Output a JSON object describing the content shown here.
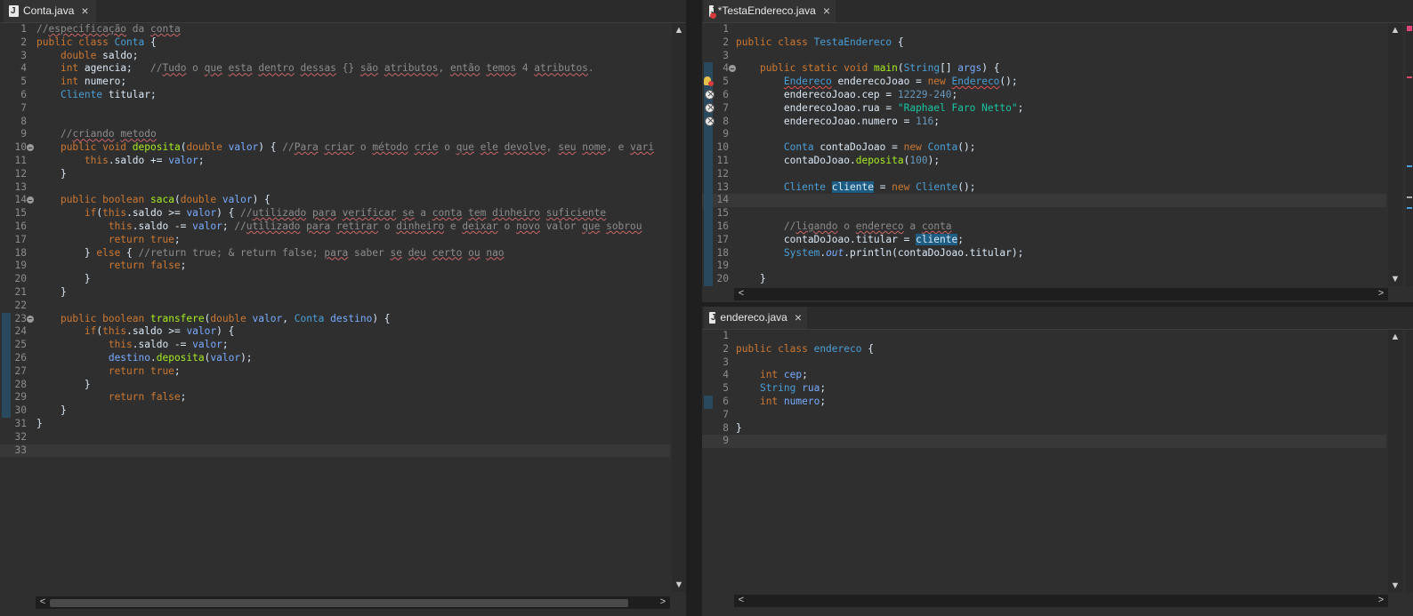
{
  "left": {
    "tab": "Conta.java",
    "lines": [
      {
        "n": 1,
        "html": "<span class=\"c\">//<span class=\"cu\">especificação</span> da <span class=\"cu\">conta</span></span>"
      },
      {
        "n": 2,
        "html": "<span class=\"k\">public class</span> <span class=\"t\">Conta</span> {"
      },
      {
        "n": 3,
        "html": "    <span class=\"k\">double</span> saldo;"
      },
      {
        "n": 4,
        "html": "    <span class=\"k\">int</span> agencia;   <span class=\"c\">//<span class=\"cu\">Tudo</span> o <span class=\"cu\">que</span> <span class=\"cu\">esta</span> <span class=\"cu\">dentro</span> <span class=\"cu\">dessas</span> {} <span class=\"cu\">são</span> <span class=\"cu\">atributos</span>, <span class=\"cu\">então</span> <span class=\"cu\">temos</span> 4 <span class=\"cu\">atributos</span>.</span>"
      },
      {
        "n": 5,
        "html": "    <span class=\"k\">int</span> numero;"
      },
      {
        "n": 6,
        "html": "    <span class=\"t\">Cliente</span> titular;"
      },
      {
        "n": 7,
        "html": ""
      },
      {
        "n": 8,
        "html": ""
      },
      {
        "n": 9,
        "html": "    <span class=\"c\">//<span class=\"cu\">criando</span> <span class=\"cu\">metodo</span></span>"
      },
      {
        "n": 10,
        "fold": true,
        "html": "    <span class=\"k\">public void</span> <span class=\"m\">deposita</span>(<span class=\"k\">double</span> <span class=\"f\">valor</span>) { <span class=\"c\">//<span class=\"cu\">Para</span> <span class=\"cu\">criar</span> o <span class=\"cu\">método</span> <span class=\"cu\">crie</span> o <span class=\"cu\">que</span> <span class=\"cu\">ele</span> <span class=\"cu\">devolve</span>, <span class=\"cu\">seu</span> <span class=\"cu\">nome</span>, e <span class=\"cu\">vari</span></span>"
      },
      {
        "n": 11,
        "html": "        <span class=\"k\">this</span>.saldo += <span class=\"f\">valor</span>;"
      },
      {
        "n": 12,
        "html": "    }"
      },
      {
        "n": 13,
        "html": ""
      },
      {
        "n": 14,
        "fold": true,
        "html": "    <span class=\"k\">public boolean</span> <span class=\"m\">saca</span>(<span class=\"k\">double</span> <span class=\"f\">valor</span>) {"
      },
      {
        "n": 15,
        "html": "        <span class=\"k\">if</span>(<span class=\"k\">this</span>.saldo >= <span class=\"f\">valor</span>) { <span class=\"c\">//<span class=\"cu\">utilizado</span> <span class=\"cu\">para</span> <span class=\"cu\">verificar</span> <span class=\"cu\">se</span> a <span class=\"cu\">conta</span> <span class=\"cu\">tem</span> <span class=\"cu\">dinheiro</span> <span class=\"cu\">suficiente</span></span>"
      },
      {
        "n": 16,
        "html": "            <span class=\"k\">this</span>.saldo -= <span class=\"f\">valor</span>; <span class=\"c\">//<span class=\"cu\">utilizado</span> <span class=\"cu\">para</span> <span class=\"cu\">retirar</span> o <span class=\"cu\">dinheiro</span> e <span class=\"cu\">deixar</span> o <span class=\"cu\">novo</span> valor <span class=\"cu\">que</span> <span class=\"cu\">sobrou</span></span>"
      },
      {
        "n": 17,
        "html": "            <span class=\"k\">return true</span>;"
      },
      {
        "n": 18,
        "html": "        } <span class=\"k\">else</span> { <span class=\"c\">//return true; &amp; return false; <span class=\"cu\">para</span> saber <span class=\"cu\">se</span> <span class=\"cu\">deu</span> <span class=\"cu\">certo</span> <span class=\"cu\">ou</span> <span class=\"cu\">nao</span></span>"
      },
      {
        "n": 19,
        "html": "            <span class=\"k\">return false</span>;"
      },
      {
        "n": 20,
        "html": "        }"
      },
      {
        "n": 21,
        "html": "    }"
      },
      {
        "n": 22,
        "html": ""
      },
      {
        "n": 23,
        "fold": true,
        "bar": true,
        "html": "    <span class=\"k\">public boolean</span> <span class=\"m\">transfere</span>(<span class=\"k\">double</span> <span class=\"f\">valor</span>, <span class=\"t\">Conta</span> <span class=\"f\">destino</span>) {"
      },
      {
        "n": 24,
        "bar": true,
        "html": "        <span class=\"k\">if</span>(<span class=\"k\">this</span>.saldo >= <span class=\"f\">valor</span>) {"
      },
      {
        "n": 25,
        "bar": true,
        "html": "            <span class=\"k\">this</span>.saldo -= <span class=\"f\">valor</span>;"
      },
      {
        "n": 26,
        "bar": true,
        "html": "            <span class=\"f\">destino</span>.<span class=\"m\">deposita</span>(<span class=\"f\">valor</span>);"
      },
      {
        "n": 27,
        "bar": true,
        "html": "            <span class=\"k\">return true</span>;"
      },
      {
        "n": 28,
        "bar": true,
        "html": "        }"
      },
      {
        "n": 29,
        "bar": true,
        "html": "            <span class=\"k\">return false</span>;"
      },
      {
        "n": 30,
        "bar": true,
        "html": "    }"
      },
      {
        "n": 31,
        "html": "}"
      },
      {
        "n": 32,
        "html": ""
      },
      {
        "n": 33,
        "cur": true,
        "html": ""
      }
    ]
  },
  "right_top": {
    "tab": "*TestaEndereco.java",
    "lines": [
      {
        "n": 1,
        "html": ""
      },
      {
        "n": 2,
        "html": "<span class=\"k\">public class</span> <span class=\"t\">TestaEndereco</span> {"
      },
      {
        "n": 3,
        "html": ""
      },
      {
        "n": 4,
        "fold": true,
        "bar": true,
        "html": "    <span class=\"k\">public static void</span> <span class=\"m\">main</span>(<span class=\"t\">String</span>[] <span class=\"f\">args</span>) {"
      },
      {
        "n": 5,
        "bar": true,
        "mark": "bulb",
        "html": "        <span class=\"t u\">Endereco</span> enderecoJoao = <span class=\"k\">new</span> <span class=\"t u\">Endereco</span>();"
      },
      {
        "n": 6,
        "bar": true,
        "mark": "err",
        "html": "        enderecoJoao.cep = <span class=\"n\">12229-240</span>;"
      },
      {
        "n": 7,
        "bar": true,
        "mark": "err",
        "html": "        enderecoJoao.rua = <span class=\"s\">\"Raphael Faro Netto\"</span>;"
      },
      {
        "n": 8,
        "bar": true,
        "mark": "err",
        "html": "        enderecoJoao.numero = <span class=\"n\">116</span>;"
      },
      {
        "n": 9,
        "bar": true,
        "html": ""
      },
      {
        "n": 10,
        "bar": true,
        "html": "        <span class=\"t\">Conta</span> contaDoJoao = <span class=\"k\">new</span> <span class=\"t\">Conta</span>();"
      },
      {
        "n": 11,
        "bar": true,
        "html": "        contaDoJoao.<span class=\"m\">deposita</span>(<span class=\"n\">100</span>);"
      },
      {
        "n": 12,
        "bar": true,
        "html": ""
      },
      {
        "n": 13,
        "bar": true,
        "html": "        <span class=\"t\">Cliente</span> <span class=\"hl\">cliente</span> = <span class=\"k\">new</span> <span class=\"t\">Cliente</span>();"
      },
      {
        "n": 14,
        "bar": true,
        "cur": true,
        "html": ""
      },
      {
        "n": 15,
        "bar": true,
        "html": ""
      },
      {
        "n": 16,
        "bar": true,
        "html": "        <span class=\"c\">//<span class=\"cu\">ligando</span> o <span class=\"cu\">endereco</span> a <span class=\"cu\">conta</span></span>"
      },
      {
        "n": 17,
        "bar": true,
        "html": "        contaDoJoao.titular = <span class=\"hl\">cliente</span>;"
      },
      {
        "n": 18,
        "bar": true,
        "html": "        <span class=\"t\">System</span>.<span class=\"i\">out</span>.println(contaDoJoao.titular);"
      },
      {
        "n": 19,
        "bar": true,
        "html": ""
      },
      {
        "n": 20,
        "bar": true,
        "html": "    }"
      }
    ]
  },
  "right_bottom": {
    "tab": "endereco.java",
    "lines": [
      {
        "n": 1,
        "html": ""
      },
      {
        "n": 2,
        "html": "<span class=\"k\">public class</span> <span class=\"t\">endereco</span> {"
      },
      {
        "n": 3,
        "html": ""
      },
      {
        "n": 4,
        "html": "    <span class=\"k\">int</span> <span class=\"f\">cep</span>;"
      },
      {
        "n": 5,
        "html": "    <span class=\"t\">String</span> <span class=\"f\">rua</span>;"
      },
      {
        "n": 6,
        "bar": true,
        "html": "    <span class=\"k\">int</span> <span class=\"f\">numero</span>;"
      },
      {
        "n": 7,
        "html": ""
      },
      {
        "n": 8,
        "html": "}"
      },
      {
        "n": 9,
        "cur": true,
        "html": ""
      }
    ]
  },
  "icons": {
    "close": "×",
    "up": "▲",
    "down": "▼",
    "left": "<",
    "right": ">"
  }
}
